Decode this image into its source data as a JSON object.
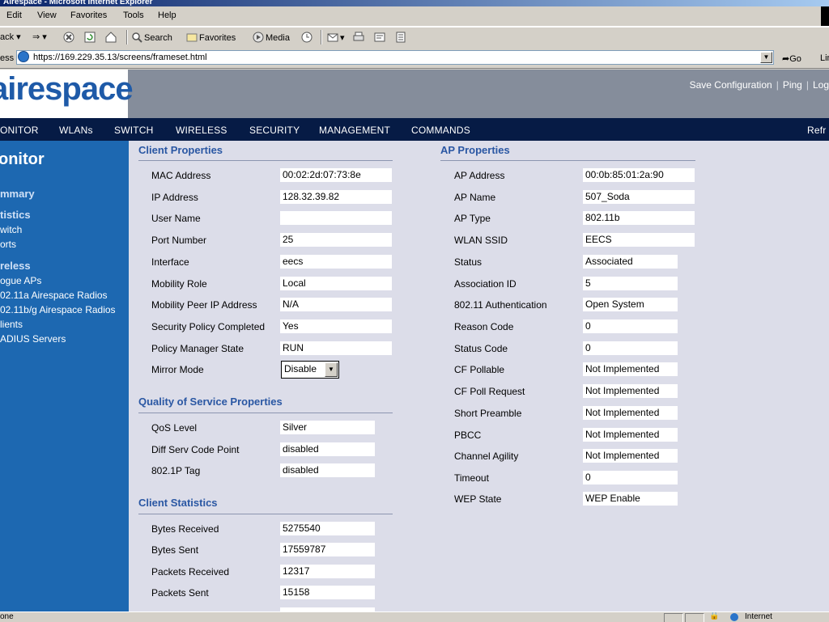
{
  "window": {
    "title": "Airespace - Microsoft Internet Explorer"
  },
  "menu": [
    "Edit",
    "View",
    "Favorites",
    "Tools",
    "Help"
  ],
  "toolbar": {
    "back": "ack",
    "search": "Search",
    "favorites": "Favorites",
    "media": "Media"
  },
  "address": {
    "label": "ess",
    "url": "https://169.229.35.13/screens/frameset.html",
    "go": "Go",
    "links": "Lin"
  },
  "header": {
    "logo": "airespace",
    "save": "Save Configuration",
    "ping": "Ping",
    "logout": "Log"
  },
  "nav": [
    "ONITOR",
    "WLANs",
    "SWITCH",
    "WIRELESS",
    "SECURITY",
    "MANAGEMENT",
    "COMMANDS"
  ],
  "nav_refresh": "Refr",
  "sidebar": {
    "title": "onitor",
    "summary": "mmary",
    "statistics": "tistics",
    "stat_items": [
      "witch",
      "orts"
    ],
    "wireless": "reless",
    "wireless_items": [
      "ogue APs",
      "02.11a Airespace Radios",
      "02.11b/g Airespace Radios",
      "lients",
      "ADIUS Servers"
    ]
  },
  "client_properties": {
    "title": "Client Properties",
    "rows": [
      {
        "label": "MAC Address",
        "value": "00:02:2d:07:73:8e"
      },
      {
        "label": "IP Address",
        "value": "128.32.39.82"
      },
      {
        "label": "User Name",
        "value": ""
      },
      {
        "label": "Port Number",
        "value": "25"
      },
      {
        "label": "Interface",
        "value": "eecs"
      },
      {
        "label": "Mobility Role",
        "value": "Local"
      },
      {
        "label": "Mobility Peer IP Address",
        "value": "N/A"
      },
      {
        "label": "Security Policy Completed",
        "value": "Yes"
      },
      {
        "label": "Policy Manager State",
        "value": "RUN"
      }
    ],
    "mirror_label": "Mirror Mode",
    "mirror_value": "Disable"
  },
  "qos": {
    "title": "Quality of Service Properties",
    "rows": [
      {
        "label": "QoS Level",
        "value": "Silver"
      },
      {
        "label": "Diff Serv Code Point",
        "value": "disabled"
      },
      {
        "label": "802.1P Tag",
        "value": "disabled"
      }
    ]
  },
  "client_stats": {
    "title": "Client Statistics",
    "rows": [
      {
        "label": "Bytes Received",
        "value": "5275540"
      },
      {
        "label": "Bytes Sent",
        "value": "17559787"
      },
      {
        "label": "Packets Received",
        "value": "12317"
      },
      {
        "label": "Packets Sent",
        "value": "15158"
      }
    ]
  },
  "ap_properties": {
    "title": "AP Properties",
    "rows": [
      {
        "label": "AP Address",
        "value": "00:0b:85:01:2a:90"
      },
      {
        "label": "AP Name",
        "value": "507_Soda"
      },
      {
        "label": "AP Type",
        "value": "802.11b"
      },
      {
        "label": "WLAN SSID",
        "value": "EECS"
      },
      {
        "label": "Status",
        "value": "Associated"
      },
      {
        "label": "Association ID",
        "value": "5"
      },
      {
        "label": "802.11 Authentication",
        "value": "Open System"
      },
      {
        "label": "Reason Code",
        "value": "0"
      },
      {
        "label": "Status Code",
        "value": "0"
      },
      {
        "label": "CF Pollable",
        "value": "Not Implemented"
      },
      {
        "label": "CF Poll Request",
        "value": "Not Implemented"
      },
      {
        "label": "Short Preamble",
        "value": "Not Implemented"
      },
      {
        "label": "PBCC",
        "value": "Not Implemented"
      },
      {
        "label": "Channel Agility",
        "value": "Not Implemented"
      },
      {
        "label": "Timeout",
        "value": "0"
      },
      {
        "label": "WEP State",
        "value": "WEP Enable"
      }
    ]
  },
  "status": {
    "left": "one",
    "zone": "Internet"
  }
}
